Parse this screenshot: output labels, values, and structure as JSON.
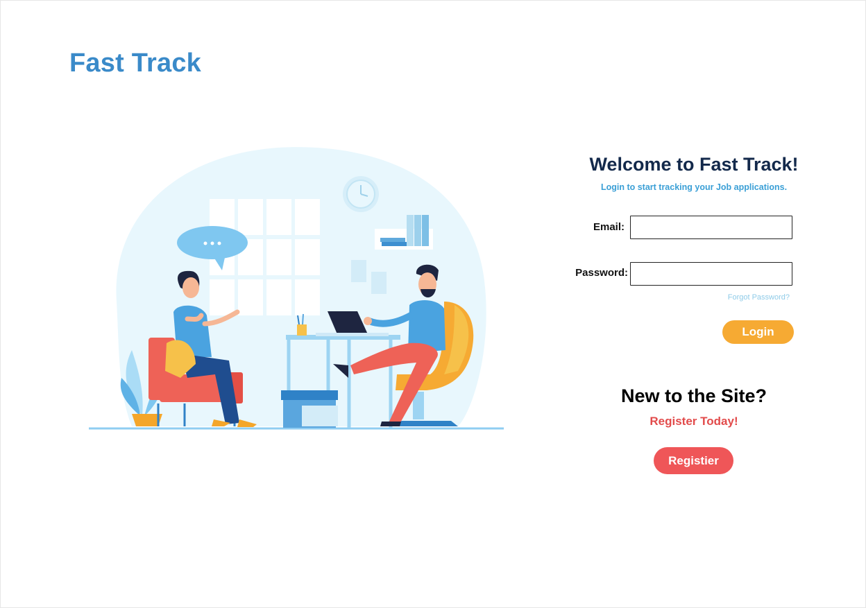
{
  "brand": {
    "title": "Fast Track",
    "color": "#3a8ac9"
  },
  "illustration": {
    "name": "job-interview-illustration"
  },
  "login": {
    "heading": "Welcome to Fast Track!",
    "subtitle": "Login to start tracking your Job applications.",
    "email_label": "Email:",
    "email_value": "",
    "password_label": "Password:",
    "password_value": "",
    "forgot_label": "Forgot Password?",
    "login_label": "Login",
    "login_color": "#f6aa33"
  },
  "register": {
    "heading": "New to the Site?",
    "tagline": "Register Today!",
    "button_label": "Registier",
    "button_color": "#ef5658"
  }
}
